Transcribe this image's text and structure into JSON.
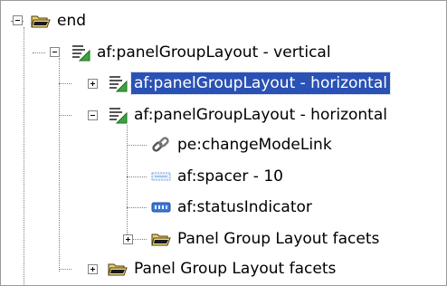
{
  "colors": {
    "selection_bg": "#2a52b4",
    "selection_text": "#ffffff",
    "connector": "#808080",
    "folder": "#d8b84a"
  },
  "tree": {
    "nodes": [
      {
        "label": "end",
        "icon": "folder-open-icon",
        "toggle": "collapse",
        "selected": false
      },
      {
        "label": "af:panelGroupLayout - vertical",
        "icon": "panel-group-layout-icon",
        "toggle": "collapse",
        "selected": false
      },
      {
        "label": "af:panelGroupLayout - horizontal",
        "icon": "panel-group-layout-icon",
        "toggle": "expand",
        "selected": true
      },
      {
        "label": "af:panelGroupLayout - horizontal",
        "icon": "panel-group-layout-icon",
        "toggle": "collapse",
        "selected": false
      },
      {
        "label": "pe:changeModeLink",
        "icon": "link-chain-icon",
        "toggle": "none",
        "selected": false
      },
      {
        "label": "af:spacer - 10",
        "icon": "spacer-icon",
        "toggle": "none",
        "selected": false
      },
      {
        "label": "af:statusIndicator",
        "icon": "status-indicator-icon",
        "toggle": "none",
        "selected": false
      },
      {
        "label": "Panel Group Layout facets",
        "icon": "folder-open-icon",
        "toggle": "expand",
        "selected": false
      },
      {
        "label": "Panel Group Layout facets",
        "icon": "folder-open-icon",
        "toggle": "expand",
        "selected": false
      }
    ]
  }
}
